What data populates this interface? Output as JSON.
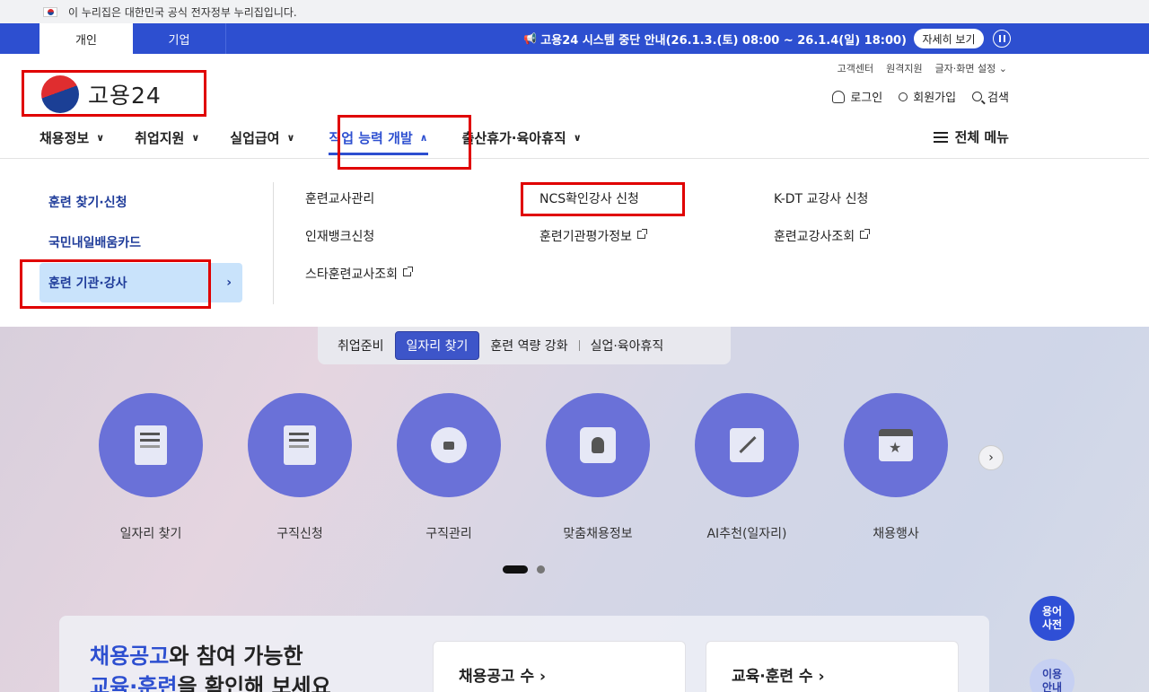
{
  "gov_banner": {
    "text": "이 누리집은 대한민국 공식 전자정부 누리집입니다."
  },
  "top_tabs": [
    "개인",
    "기업"
  ],
  "notice": {
    "text": "고용24 시스템 중단 안내(26.1.3.(토) 08:00 ~ 26.1.4(일) 18:00)",
    "detail_label": "자세히 보기"
  },
  "logo": {
    "text": "고용24"
  },
  "util_links": [
    "고객센터",
    "원격지원",
    "글자·화면 설정"
  ],
  "auth": {
    "login": "로그인",
    "signup": "회원가입",
    "search": "검색"
  },
  "gnb": [
    "채용정보",
    "취업지원",
    "실업급여",
    "직업 능력 개발",
    "출산휴가·육아휴직"
  ],
  "all_menu": "전체 메뉴",
  "dropdown": {
    "left": [
      "훈련 찾기·신청",
      "국민내일배움카드",
      "훈련 기관·강사"
    ],
    "col1": [
      "훈련교사관리",
      "인재뱅크신청",
      "스타훈련교사조회"
    ],
    "col2": [
      "NCS확인강사 신청",
      "훈련기관평가정보"
    ],
    "col3": [
      "K-DT 교강사 신청",
      "훈련교강사조회"
    ]
  },
  "seg_tabs": [
    "취업준비",
    "일자리 찾기",
    "훈련 역량 강화",
    "실업·육아휴직"
  ],
  "services": [
    {
      "label": "일자리 찾기",
      "icon": "job-search-icon"
    },
    {
      "label": "구직신청",
      "icon": "application-check-icon"
    },
    {
      "label": "구직관리",
      "icon": "briefcase-gear-icon"
    },
    {
      "label": "맞춤채용정보",
      "icon": "puzzle-person-icon"
    },
    {
      "label": "AI추천(일자리)",
      "icon": "magic-wand-icon"
    },
    {
      "label": "채용행사",
      "icon": "calendar-star-icon"
    }
  ],
  "promo": {
    "line1_highlight": "채용공고",
    "line1_rest": "와 참여 가능한",
    "line2_highlight": "교육·훈련",
    "line2_rest": "을 확인해 보세요",
    "stat1": "채용공고 수",
    "stat2": "교육·훈련 수"
  },
  "side_buttons": {
    "glossary_1": "용어",
    "glossary_2": "사전",
    "guide_1": "이용",
    "guide_2": "안내"
  },
  "colors": {
    "primary": "#2d4fd0",
    "service_circle": "#6a71d8",
    "highlight_box": "#e00000",
    "selected_menu": "#c9e3fb"
  }
}
